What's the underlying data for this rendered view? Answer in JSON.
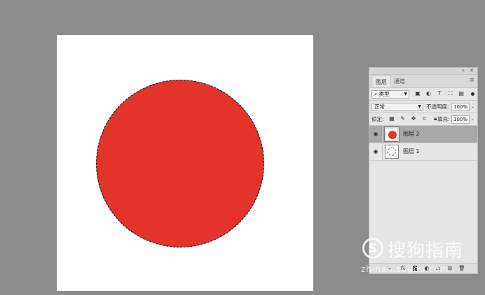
{
  "panel": {
    "tabs": [
      {
        "label": "图层",
        "active": true
      },
      {
        "label": "通道",
        "active": false
      }
    ],
    "kind_filter": "类型",
    "blend_mode": "正常",
    "opacity_label": "不透明度:",
    "opacity_value": "100%",
    "lock_label": "锁定:",
    "fill_label": "填充:",
    "fill_value": "100%",
    "layers": [
      {
        "name": "图层 2",
        "selected": true,
        "thumb": "red-circle"
      },
      {
        "name": "图层 1",
        "selected": false,
        "thumb": "sketch"
      }
    ],
    "bottom_icons": [
      "link-icon",
      "fx-icon",
      "mask-icon",
      "adjustment-icon",
      "folder-icon",
      "new-layer-icon",
      "trash-icon"
    ],
    "bottom_fx": "fx"
  },
  "canvas": {
    "background": "#ffffff",
    "shape_color": "#e3332b",
    "selection": "circle"
  },
  "watermark": {
    "logo": "S",
    "text": "搜狗指南",
    "url": "zhinan.sogou.com"
  }
}
